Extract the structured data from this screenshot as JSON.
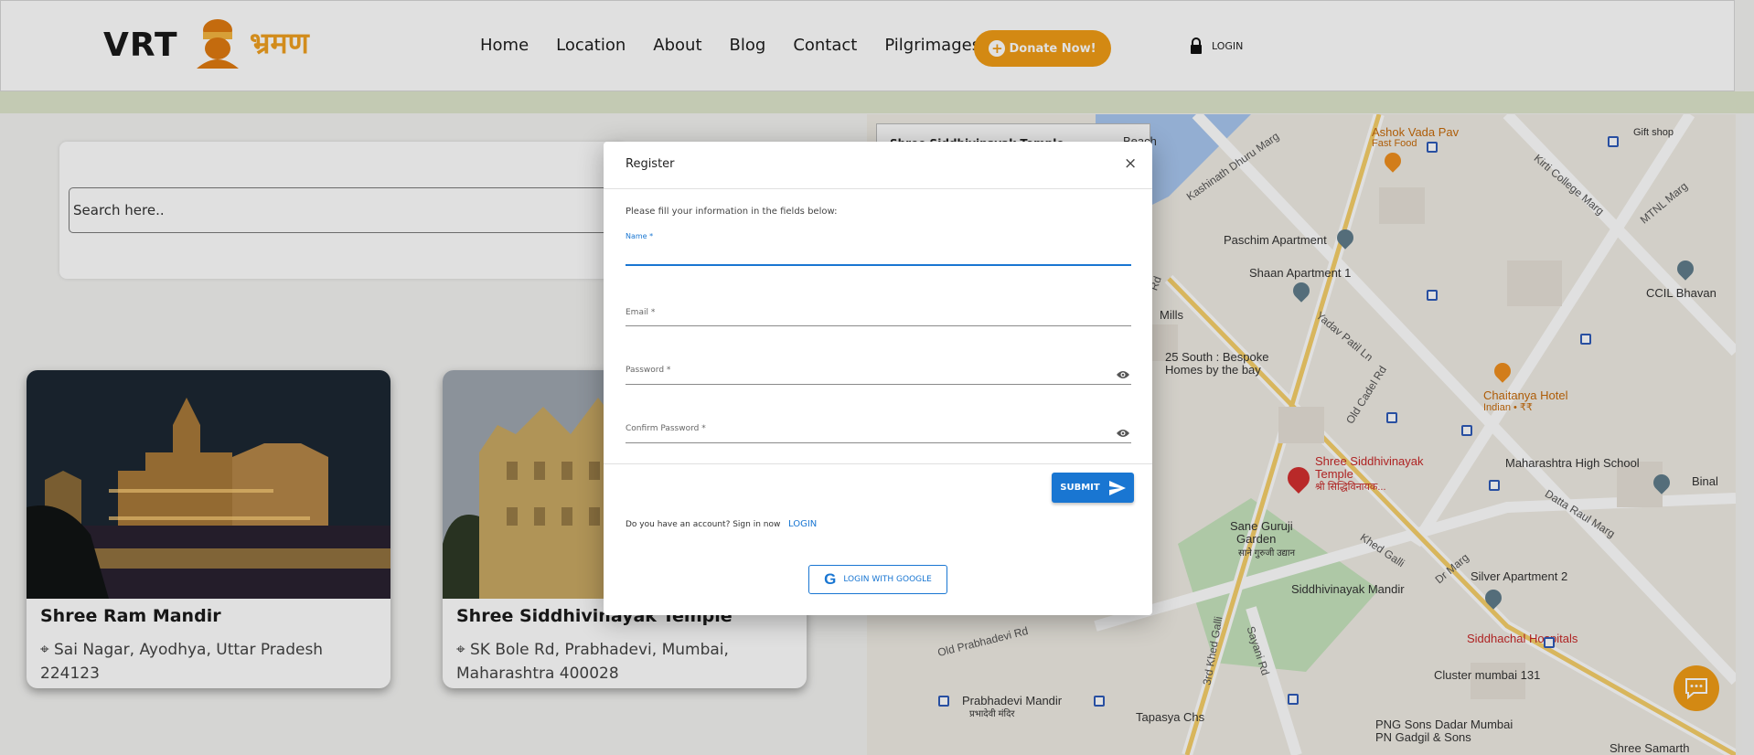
{
  "header": {
    "logo_text": "VRT",
    "logo_devanagari": "भ्रमण",
    "nav": [
      "Home",
      "Location",
      "About",
      "Blog",
      "Contact",
      "Pilgrimages"
    ],
    "donate_label": "Donate Now!",
    "login_label": "LOGIN"
  },
  "search": {
    "placeholder": "Search here.."
  },
  "cards": [
    {
      "title": "Shree Ram Mandir",
      "address": "Sai Nagar, Ayodhya, Uttar Pradesh 224123"
    },
    {
      "title": "Shree Siddhivinayak Temple",
      "address": "SK Bole Rd, Prabhadevi, Mumbai, Maharashtra 400028"
    }
  ],
  "map": {
    "info_box": "Shree Siddhivinayak Temple",
    "labels": {
      "ashok": "Ashok Vada Pav",
      "fastfood": "Fast Food",
      "beach": "Beach",
      "gift": "Gift shop",
      "paschim": "Paschim Apartment",
      "shaan": "Shaan Apartment 1",
      "mills": "Mills",
      "south25a": "25 South : Bespoke",
      "south25b": "Homes by the bay",
      "chaitanya": "Chaitanya Hotel",
      "chaitanya_sub": "Indian • ₹₹",
      "ccil": "CCIL Bhavan",
      "temple_a": "Shree Siddhivinayak",
      "temple_b": "Temple",
      "temple_c": "श्री सिद्धिविनायक...",
      "mhs": "Maharashtra High School",
      "sane_a": "Sane Guruji",
      "sane_b": "Garden",
      "sane_c": "साने गुरुजी उद्यान",
      "sidd_mandir": "Siddhivinayak Mandir",
      "silver": "Silver Apartment 2",
      "siddhachal": "Siddhachal Hospitals",
      "cluster": "Cluster mumbai 131",
      "prabhadevi_a": "Prabhadevi Mandir",
      "prabhadevi_b": "प्रभादेवी मंदिर",
      "tapasya": "Tapasya Chs",
      "png_a": "PNG Sons Dadar Mumbai",
      "png_b": "PN Gadgil & Sons",
      "samarth": "Shree Samarth",
      "bina": "Binal"
    },
    "roads": {
      "old_cadel": "Old Cadel Rd",
      "kashinath": "Kashinath Dhuru Marg",
      "kirti": "Kirti College Marg",
      "mtnl": "MTNL Marg",
      "yadav": "Yadav Patil Ln",
      "datta": "Datta Raul Marg",
      "khed": "Khed Galli",
      "sayani": "Sayani Rd",
      "old_prabhadevi": "Old Prabhadevi Rd",
      "third_khed": "3rd Khed Galli",
      "dr_marg": "Dr Marg",
      "rd": "Rd"
    }
  },
  "modal": {
    "title": "Register",
    "close_label": "×",
    "intro": "Please fill your information in the fields below:",
    "fields": {
      "name": "Name *",
      "email": "Email *",
      "password": "Password *",
      "confirm": "Confirm Password *"
    },
    "submit_label": "SUBMIT",
    "account_text": "Do you have an account? Sign in now",
    "login_link": "LOGIN",
    "google_label": "LOGIN WITH GOOGLE"
  },
  "colors": {
    "accent": "#1976d2",
    "donate": "#f19c16",
    "map_pin": "#d32f2f"
  }
}
